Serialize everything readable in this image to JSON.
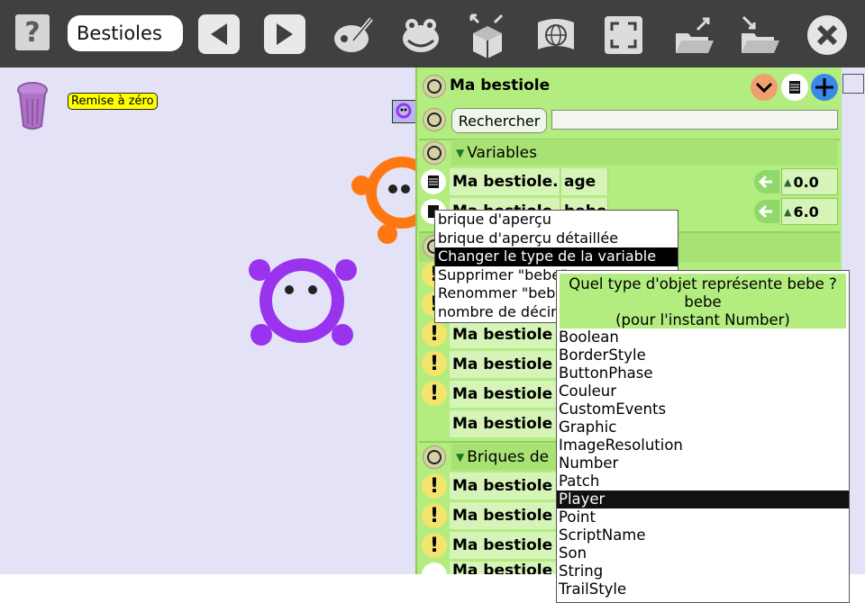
{
  "toolbar": {
    "help_label": "?",
    "project_name": "Bestioles"
  },
  "world": {
    "reset_label": "Remise à zéro",
    "colors": {
      "orange_creature": "#ff7711",
      "purple_creature": "#9933ee",
      "background": "#e3e2f6"
    }
  },
  "viewer": {
    "title": "Ma bestiole",
    "search_label": "Rechercher",
    "search_value": "",
    "variables_header": "Variables",
    "var_rows": [
      {
        "owner": "Ma bestiole.",
        "name": "age",
        "value": "0.0"
      },
      {
        "owner": "Ma bestiole",
        "name": "bebe",
        "value": "6.0"
      }
    ],
    "bestiole_tiles": [
      "Ma bestiole",
      "Ma bestiole",
      "Ma bestiole",
      "Ma bestiole",
      "Ma bestiole"
    ],
    "bricks_header": "Briques de",
    "bricks_tiles": [
      "Ma bestiole",
      "Ma bestiole",
      "Ma bestiole",
      "Ma bestiole"
    ]
  },
  "context_menu": {
    "items": [
      "brique d'aperçu",
      "brique d'aperçu détaillée",
      "Changer le type de la variable",
      "Supprimer \"bebe\"",
      "Renommer \"bebe\"",
      "nombre de décimales"
    ],
    "selected_index": 2
  },
  "type_dialog": {
    "question_line1": "Quel type d'objet représente bebe ?",
    "question_line2": "bebe",
    "question_line3": "(pour l'instant Number)",
    "options": [
      "Boolean",
      "BorderStyle",
      "ButtonPhase",
      "Couleur",
      "CustomEvents",
      "Graphic",
      "ImageResolution",
      "Number",
      "Patch",
      "Player",
      "Point",
      "ScriptName",
      "Son",
      "String",
      "TrailStyle"
    ],
    "selected": "Player"
  }
}
